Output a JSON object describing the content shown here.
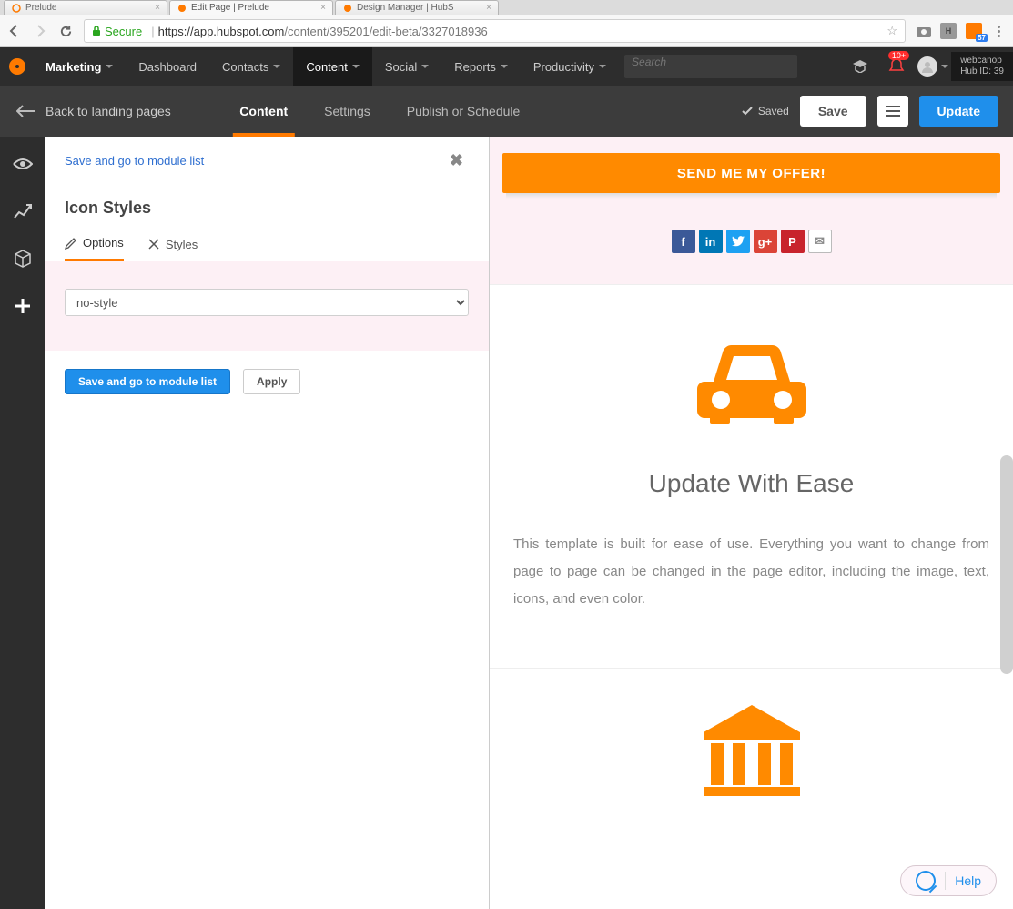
{
  "browser": {
    "tabs": [
      {
        "label": "Prelude",
        "active": false
      },
      {
        "label": "Edit Page | Prelude",
        "active": true
      },
      {
        "label": "Design Manager | HubS",
        "active": false
      }
    ],
    "secure_label": "Secure",
    "url_host": "https://app.hubspot.com",
    "url_path": "/content/395201/edit-beta/3327018936",
    "ext_badge": "57"
  },
  "topnav": {
    "brand": "Marketing",
    "items": [
      "Dashboard",
      "Contacts",
      "Content",
      "Social",
      "Reports",
      "Productivity"
    ],
    "active": "Content",
    "search_placeholder": "Search",
    "notif_count": "10+",
    "account_name": "webcanop",
    "hub_id": "Hub ID: 39"
  },
  "pagebar": {
    "back_label": "Back to landing pages",
    "tabs": [
      "Content",
      "Settings",
      "Publish or Schedule"
    ],
    "active": "Content",
    "saved_label": "Saved",
    "save_btn": "Save",
    "update_btn": "Update"
  },
  "panel": {
    "link": "Save and go to module list",
    "title": "Icon Styles",
    "tabs": [
      "Options",
      "Styles"
    ],
    "active_tab": "Options",
    "select_value": "no-style",
    "primary_btn": "Save and go to module list",
    "secondary_btn": "Apply"
  },
  "preview": {
    "cta": "SEND ME MY OFFER!",
    "section_title": "Update With Ease",
    "section_body": "This template is built for ease of use. Everything you want to change from page to page can be changed in the page editor, including the image, text, icons, and even color."
  },
  "help": {
    "label": "Help"
  }
}
